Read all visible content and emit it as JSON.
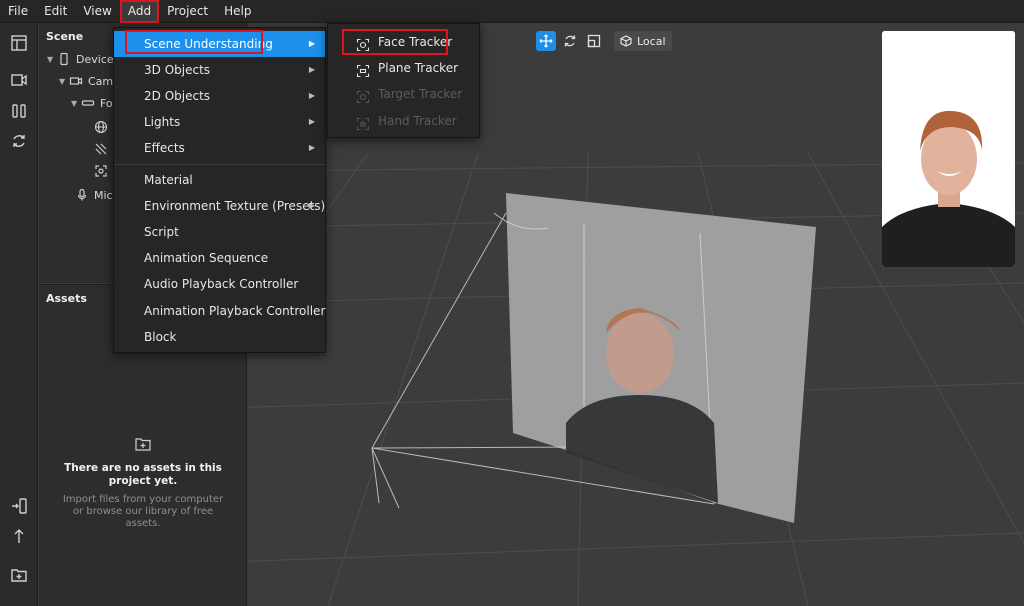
{
  "menubar": {
    "items": [
      "File",
      "Edit",
      "View",
      "Add",
      "Project",
      "Help"
    ]
  },
  "scene": {
    "title": "Scene",
    "tree": [
      {
        "label": "Device",
        "icon": "device-icon"
      },
      {
        "label": "Camera",
        "icon": "camera-icon"
      },
      {
        "label": "Focal Plane",
        "icon": "focal-plane-icon"
      },
      {
        "label": "",
        "icon": "globe-icon"
      },
      {
        "label": "",
        "icon": "light-icon"
      },
      {
        "label": "",
        "icon": "tracker-icon"
      },
      {
        "label": "Microphone",
        "icon": "microphone-icon"
      }
    ]
  },
  "assets": {
    "title": "Assets",
    "empty_title": "There are no assets in this project yet.",
    "empty_subtitle": "Import files from your computer or browse our library of free assets."
  },
  "add_menu": {
    "items": [
      {
        "label": "Scene Understanding",
        "has_submenu": true,
        "selected": true
      },
      {
        "label": "3D Objects",
        "has_submenu": true
      },
      {
        "label": "2D Objects",
        "has_submenu": true
      },
      {
        "label": "Lights",
        "has_submenu": true
      },
      {
        "label": "Effects",
        "has_submenu": true
      },
      {
        "label": "Material",
        "has_submenu": false
      },
      {
        "label": "Environment Texture (Presets)",
        "has_submenu": true
      },
      {
        "label": "Script",
        "has_submenu": false
      },
      {
        "label": "Animation Sequence",
        "has_submenu": false
      },
      {
        "label": "Audio Playback Controller",
        "has_submenu": false
      },
      {
        "label": "Animation Playback Controller",
        "has_submenu": false
      },
      {
        "label": "Block",
        "has_submenu": false
      }
    ]
  },
  "scene_understanding_menu": {
    "items": [
      {
        "label": "Face Tracker",
        "enabled": true
      },
      {
        "label": "Plane Tracker",
        "enabled": true
      },
      {
        "label": "Target Tracker",
        "enabled": false
      },
      {
        "label": "Hand Tracker",
        "enabled": false
      }
    ]
  },
  "viewport": {
    "local_label": "Local",
    "accent_color": "#1e8fe6"
  },
  "colors": {
    "highlight_outline": "#e0141e",
    "menu_selected": "#1c90ea"
  }
}
